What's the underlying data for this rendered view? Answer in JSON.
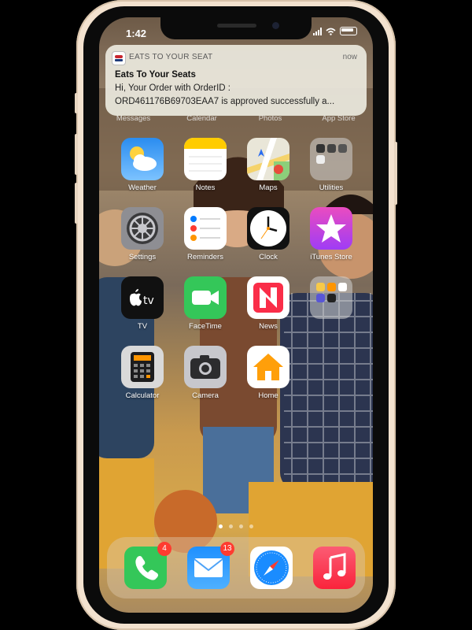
{
  "status": {
    "time": "1:42"
  },
  "notification": {
    "app": "EATS TO YOUR SEAT",
    "time": "now",
    "title": "Eats To Your Seats",
    "line1": "Hi, Your Order with OrderID :",
    "line2": "ORD461176B69703EAA7 is approved successfully a..."
  },
  "hidden_labels": [
    "Messages",
    "Calendar",
    "Photos",
    "App Store"
  ],
  "apps": [
    {
      "label": "Weather",
      "icon": "weather-icon"
    },
    {
      "label": "Notes",
      "icon": "notes-icon"
    },
    {
      "label": "Maps",
      "icon": "maps-icon"
    },
    {
      "label": "Utilities",
      "icon": "folder-icon"
    },
    {
      "label": "Settings",
      "icon": "settings-gear-icon"
    },
    {
      "label": "Reminders",
      "icon": "reminders-icon"
    },
    {
      "label": "Clock",
      "icon": "clock-icon"
    },
    {
      "label": "iTunes Store",
      "icon": "star-icon"
    },
    {
      "label": "TV",
      "icon": "apple-tv-icon"
    },
    {
      "label": "FaceTime",
      "icon": "video-camera-icon"
    },
    {
      "label": "News",
      "icon": "news-icon"
    },
    {
      "label": "",
      "icon": "folder-icon"
    },
    {
      "label": "Calculator",
      "icon": "calculator-icon"
    },
    {
      "label": "Camera",
      "icon": "camera-icon"
    },
    {
      "label": "Home",
      "icon": "house-icon"
    }
  ],
  "tv_text": "tv",
  "page_dots": {
    "count": 4,
    "active": 0
  },
  "dock": [
    {
      "name": "Phone",
      "icon": "phone-icon",
      "badge": "4"
    },
    {
      "name": "Mail",
      "icon": "mail-icon",
      "badge": "13"
    },
    {
      "name": "Safari",
      "icon": "compass-icon",
      "badge": ""
    },
    {
      "name": "Music",
      "icon": "music-note-icon",
      "badge": ""
    }
  ],
  "colors": {
    "badge": "#ff3b30",
    "facetime": "#34c759",
    "itunes": "#ea4cc0"
  }
}
